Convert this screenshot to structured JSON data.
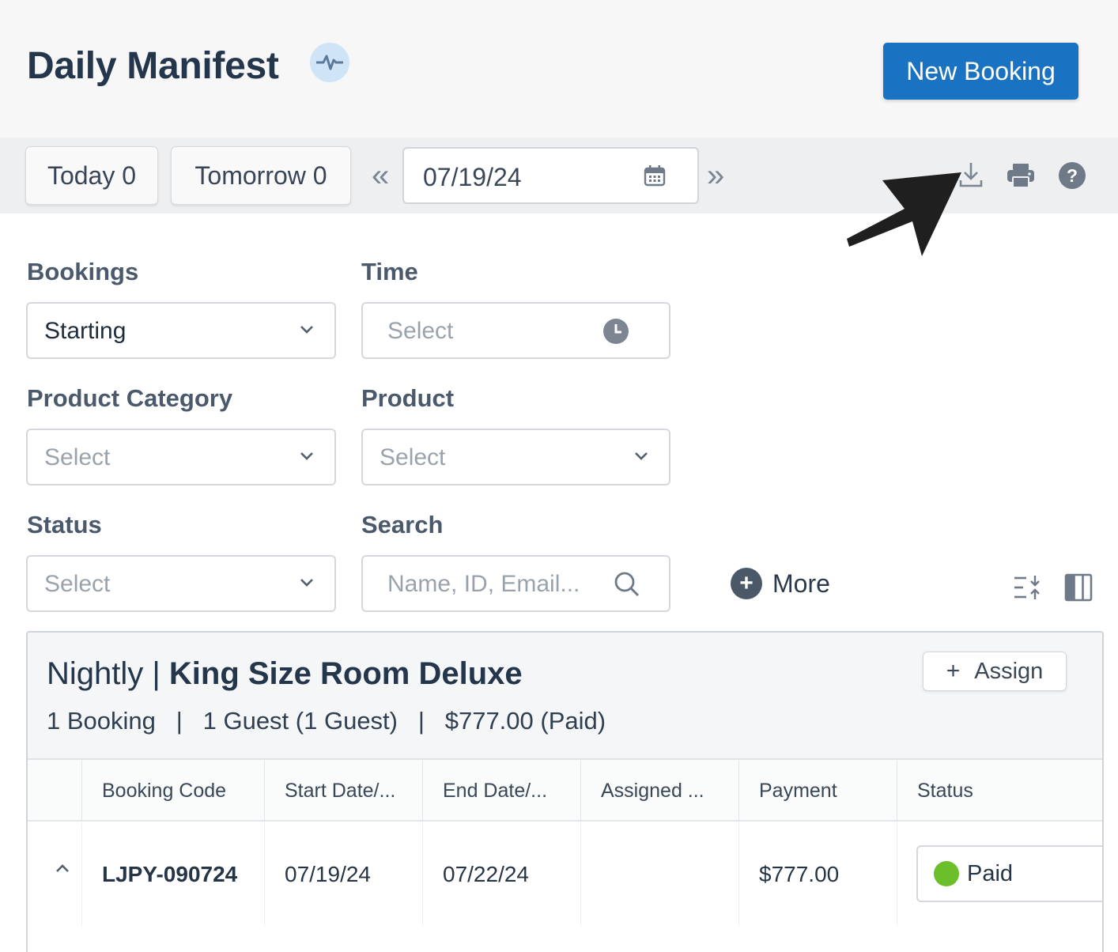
{
  "header": {
    "title": "Daily Manifest",
    "new_booking_label": "New Booking"
  },
  "toolbar": {
    "today_label": "Today 0",
    "tomorrow_label": "Tomorrow 0",
    "prev_arrow": "«",
    "next_arrow": "»",
    "date_value": "07/19/24"
  },
  "filters": {
    "bookings": {
      "label": "Bookings",
      "value": "Starting"
    },
    "time": {
      "label": "Time",
      "placeholder": "Select"
    },
    "product_category": {
      "label": "Product Category",
      "placeholder": "Select"
    },
    "product": {
      "label": "Product",
      "placeholder": "Select"
    },
    "status": {
      "label": "Status",
      "placeholder": "Select"
    },
    "search": {
      "label": "Search",
      "placeholder": "Name, ID, Email..."
    },
    "more_label": "More"
  },
  "group": {
    "title_prefix": "Nightly | ",
    "title_name": "King Size Room Deluxe",
    "summary": "1 Booking   |   1 Guest (1 Guest)   |   $777.00 (Paid)",
    "assign_label": "Assign",
    "columns": [
      "Booking Code",
      "Start Date/...",
      "End Date/...",
      "Assigned ...",
      "Payment",
      "Status"
    ],
    "rows": [
      {
        "booking_code": "LJPY-090724",
        "start_date": "07/19/24",
        "end_date": "07/22/24",
        "assigned": "",
        "payment": "$777.00",
        "status": "Paid"
      }
    ]
  },
  "colors": {
    "primary": "#1a73c2",
    "paid_status": "#6cbf2a",
    "title_text": "#24364b"
  }
}
